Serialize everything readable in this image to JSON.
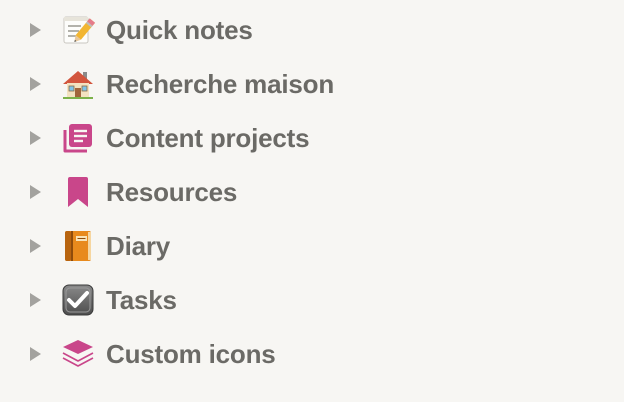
{
  "sidebar": {
    "items": [
      {
        "label": "Quick notes",
        "icon": "memo-pencil-icon"
      },
      {
        "label": "Recherche maison",
        "icon": "house-icon"
      },
      {
        "label": "Content projects",
        "icon": "document-list-icon"
      },
      {
        "label": "Resources",
        "icon": "bookmark-icon"
      },
      {
        "label": "Diary",
        "icon": "notebook-icon"
      },
      {
        "label": "Tasks",
        "icon": "checkbox-icon"
      },
      {
        "label": "Custom icons",
        "icon": "layers-icon"
      }
    ]
  },
  "colors": {
    "background": "#f7f6f3",
    "label": "#6b6a66",
    "toggle": "#a3a29e",
    "accent_pink": "#c9468a"
  }
}
